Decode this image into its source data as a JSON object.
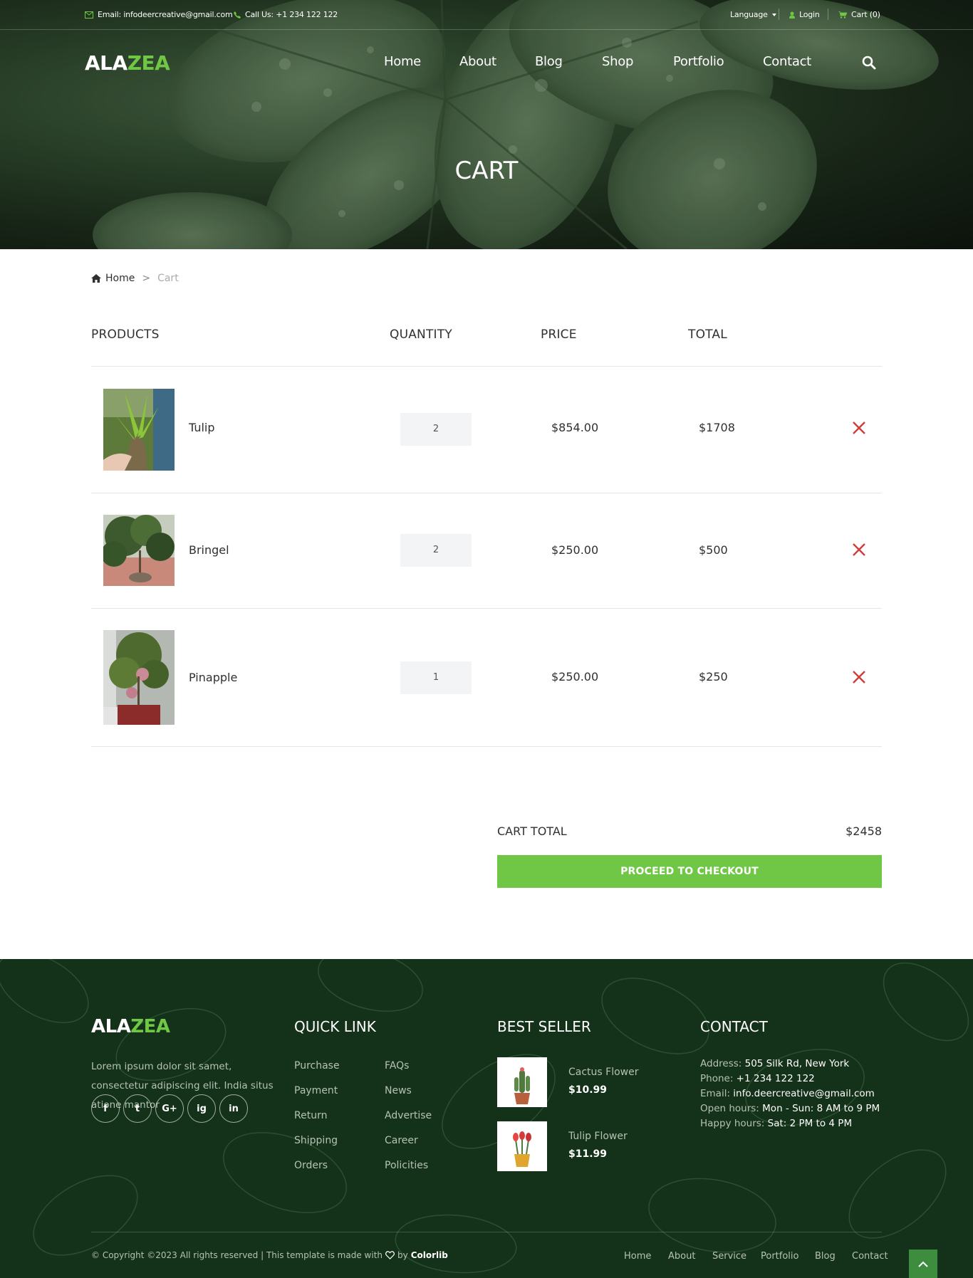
{
  "topbar": {
    "email": "Email: infodeercreative@gmail.com",
    "call": "Call Us: +1 234 122 122",
    "language": "Language",
    "login": "Login",
    "cart": "Cart (0)"
  },
  "brand": {
    "part1": "ALA",
    "part2": "ZEA"
  },
  "nav": [
    "Home",
    "About",
    "Blog",
    "Shop",
    "Portfolio",
    "Contact"
  ],
  "hero": {
    "title": "CART"
  },
  "breadcrumb": {
    "home": "Home",
    "sep": ">",
    "current": "Cart"
  },
  "table": {
    "headers": [
      "PRODUCTS",
      "QUANTITY",
      "PRICE",
      "TOTAL"
    ],
    "rows": [
      {
        "name": "Tulip",
        "quantity": "2",
        "price": "$854.00",
        "total": "$1708"
      },
      {
        "name": "Bringel",
        "quantity": "2",
        "price": "$250.00",
        "total": "$500"
      },
      {
        "name": "Pinapple",
        "quantity": "1",
        "price": "$250.00",
        "total": "$250"
      }
    ]
  },
  "cart_summary": {
    "label": "CART TOTAL",
    "value": "$2458",
    "checkout": "PROCEED TO CHECKOUT"
  },
  "footer": {
    "about_text": "Lorem ipsum dolor sit samet, consectetur adipiscing elit. India situs atione mantor",
    "socials": [
      "f",
      "t",
      "G+",
      "ig",
      "in"
    ],
    "headings": {
      "quick": "QUICK LINK",
      "best": "BEST SELLER",
      "contact": "CONTACT"
    },
    "quick_links_col1": [
      "Purchase",
      "Payment",
      "Return",
      "Shipping",
      "Orders"
    ],
    "quick_links_col2": [
      "FAQs",
      "News",
      "Advertise",
      "Career",
      "Policities"
    ],
    "best_sellers": [
      {
        "name": "Cactus Flower",
        "price": "$10.99"
      },
      {
        "name": "Tulip Flower",
        "price": "$11.99"
      }
    ],
    "contact": [
      {
        "label": "Address: ",
        "value": "505 Silk Rd, New York"
      },
      {
        "label": "Phone: ",
        "value": "+1 234 122 122"
      },
      {
        "label": "Email: ",
        "value": "info.deercreative@gmail.com"
      },
      {
        "label": "Open hours: ",
        "value": "Mon - Sun: 8 AM to 9 PM"
      },
      {
        "label": "Happy hours: ",
        "value": "Sat: 2 PM to 4 PM"
      }
    ],
    "copyright": "© Copyright ©2023 All rights reserved | This template is made with",
    "copyright_by": "by",
    "copyright_brand": "Colorlib",
    "nav": [
      "Home",
      "About",
      "Service",
      "Portfolio",
      "Blog",
      "Contact"
    ]
  },
  "colors": {
    "accent": "#70c745",
    "footer_bg": "#143119",
    "remove": "#d33c3c"
  },
  "icons": [
    "envelope-icon",
    "phone-icon",
    "user-icon",
    "cart-icon",
    "search-icon",
    "home-icon",
    "close-icon",
    "heart-icon",
    "chevron-up-icon"
  ]
}
